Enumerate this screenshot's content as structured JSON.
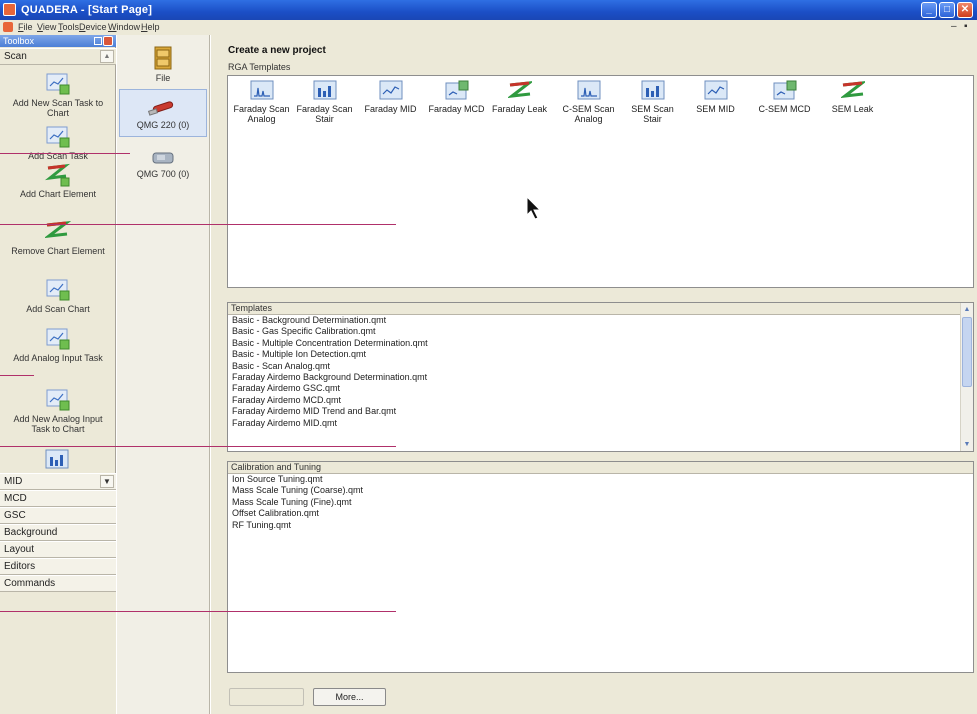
{
  "window": {
    "title": "QUADERA - [Start Page]"
  },
  "menu": {
    "items": [
      "File",
      "View",
      "Tools",
      "Device",
      "Window",
      "Help"
    ]
  },
  "toolbox": {
    "title": "Toolbox",
    "top_tab": "Scan",
    "tools": [
      {
        "label": "Add New Scan Task to Chart",
        "icon": "scan-chart-add-icon"
      },
      {
        "label": "Add Scan Task",
        "icon": "scan-task-add-icon"
      },
      {
        "label": "Add Chart Element",
        "icon": "chart-element-add-icon"
      },
      {
        "label": "Remove Chart Element",
        "icon": "chart-element-remove-icon"
      },
      {
        "label": "Add Scan Chart",
        "icon": "scan-chart-icon"
      },
      {
        "label": "Add Analog Input Task",
        "icon": "analog-input-add-icon"
      },
      {
        "label": "Add New Analog Input Task to Chart",
        "icon": "analog-input-chart-add-icon"
      }
    ],
    "bottom_tabs": [
      "MID",
      "MCD",
      "GSC",
      "Background",
      "Layout",
      "Editors",
      "Commands"
    ]
  },
  "devices": {
    "items": [
      {
        "label": "File",
        "icon": "file-cabinet-icon"
      },
      {
        "label": "QMG 220 (0)",
        "icon": "qmg220-device-icon"
      },
      {
        "label": "QMG 700 (0)",
        "icon": "qmg700-device-icon"
      }
    ]
  },
  "main": {
    "heading": "Create a new project",
    "rga_title": "RGA Templates",
    "rga_templates": [
      {
        "label": "Faraday Scan Analog",
        "icon": "scan-analog-icon"
      },
      {
        "label": "Faraday Scan Stair",
        "icon": "scan-stair-icon"
      },
      {
        "label": "Faraday MID",
        "icon": "mid-icon"
      },
      {
        "label": "Faraday MCD",
        "icon": "mcd-icon"
      },
      {
        "label": "Faraday Leak",
        "icon": "leak-icon"
      },
      {
        "label": "C-SEM Scan Analog",
        "icon": "scan-analog-icon"
      },
      {
        "label": "SEM Scan Stair",
        "icon": "scan-stair-icon"
      },
      {
        "label": "SEM MID",
        "icon": "mid-icon"
      },
      {
        "label": "C-SEM MCD",
        "icon": "mcd-icon"
      },
      {
        "label": "SEM Leak",
        "icon": "leak-icon"
      }
    ],
    "templates": {
      "header": "Templates",
      "items": [
        "Basic - Background Determination.qmt",
        "Basic - Gas Specific Calibration.qmt",
        "Basic - Multiple Concentration Determination.qmt",
        "Basic - Multiple Ion Detection.qmt",
        "Basic - Scan Analog.qmt",
        "Faraday Airdemo Background Determination.qmt",
        "Faraday Airdemo GSC.qmt",
        "Faraday Airdemo MCD.qmt",
        "Faraday Airdemo MID Trend and Bar.qmt",
        "Faraday Airdemo MID.qmt"
      ]
    },
    "calibration": {
      "header": "Calibration and Tuning",
      "items": [
        "Ion Source Tuning.qmt",
        "Mass Scale Tuning (Coarse).qmt",
        "Mass Scale Tuning (Fine).qmt",
        "Offset Calibration.qmt",
        "RF Tuning.qmt"
      ]
    },
    "buttons": {
      "ok": "",
      "more": "More..."
    }
  },
  "colors": {
    "title_bar": "#1b4fc6",
    "callout": "#b0306a",
    "chrome": "#ece9d8"
  }
}
